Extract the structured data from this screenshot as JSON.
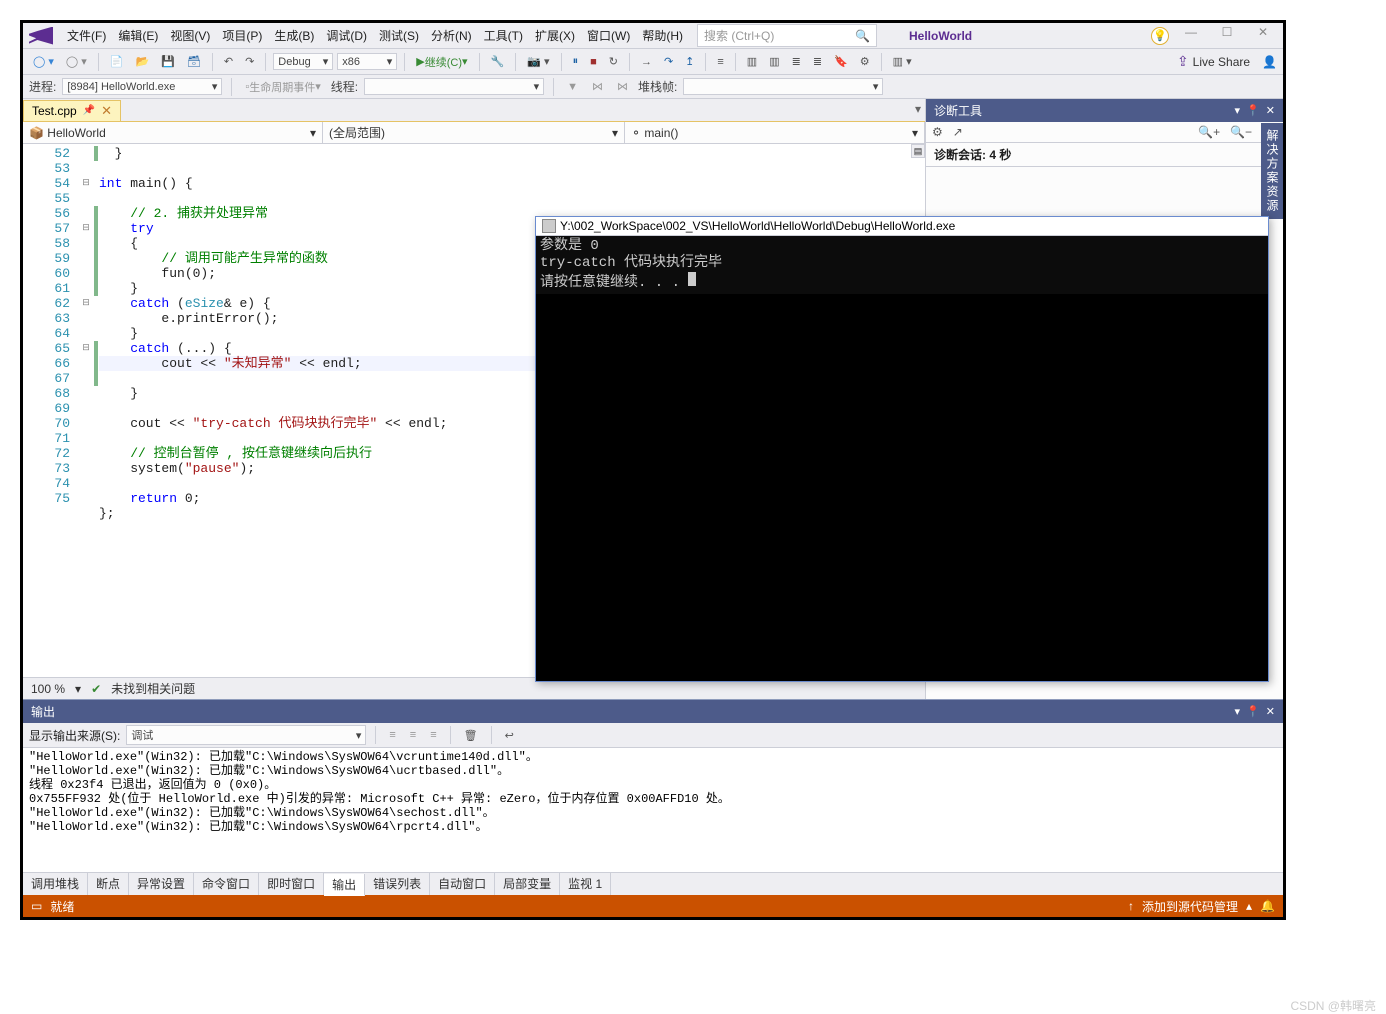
{
  "menu": {
    "items": [
      "文件(F)",
      "编辑(E)",
      "视图(V)",
      "项目(P)",
      "生成(B)",
      "调试(D)",
      "测试(S)",
      "分析(N)",
      "工具(T)",
      "扩展(X)",
      "窗口(W)",
      "帮助(H)"
    ]
  },
  "search_placeholder": "搜索 (Ctrl+Q)",
  "solution_name": "HelloWorld",
  "toolbar": {
    "config": "Debug",
    "platform": "x86",
    "continue": "继续(C)",
    "live_share": "Live Share"
  },
  "toolbar2": {
    "process_label": "进程:",
    "process": "[8984] HelloWorld.exe",
    "lifecycle": "生命周期事件",
    "thread_label": "线程:",
    "stackframe": "堆栈帧:"
  },
  "doc": {
    "tab": "Test.cpp",
    "scope": "HelloWorld",
    "scope2": "(全局范围)",
    "scope3": "main()"
  },
  "code": {
    "lines": [
      {
        "n": 52,
        "c": "g",
        "html": "  }"
      },
      {
        "n": 53,
        "c": "",
        "html": ""
      },
      {
        "n": 54,
        "c": "",
        "fold": "⊟",
        "html": "<span class='kw'>int</span> main() {"
      },
      {
        "n": 55,
        "c": "",
        "html": ""
      },
      {
        "n": 56,
        "c": "g",
        "html": "    <span class='cm'>// 2. 捕获并处理异常</span>"
      },
      {
        "n": 57,
        "c": "g",
        "fold": "⊟",
        "html": "    <span class='kw'>try</span>"
      },
      {
        "n": 58,
        "c": "g",
        "html": "    {"
      },
      {
        "n": 59,
        "c": "g",
        "html": "        <span class='cm'>// 调用可能产生异常的函数</span>"
      },
      {
        "n": 60,
        "c": "g",
        "html": "        fun(0);"
      },
      {
        "n": 61,
        "c": "g",
        "html": "    }"
      },
      {
        "n": 62,
        "c": "",
        "fold": "⊟",
        "html": "    <span class='kw'>catch</span> (<span class='ty'>eSize</span>&amp; e) {"
      },
      {
        "n": 63,
        "c": "",
        "html": "        e.printError();"
      },
      {
        "n": 64,
        "c": "",
        "html": "    }"
      },
      {
        "n": 65,
        "c": "g",
        "fold": "⊟",
        "html": "    <span class='kw'>catch</span> (...) {"
      },
      {
        "n": 66,
        "c": "g",
        "hl": true,
        "html": "        cout &lt;&lt; <span class='st'>\"未知异常\"</span> &lt;&lt; endl;"
      },
      {
        "n": 67,
        "c": "g",
        "html": "    }"
      },
      {
        "n": 68,
        "c": "",
        "html": ""
      },
      {
        "n": 69,
        "c": "",
        "html": "    cout &lt;&lt; <span class='st'>\"try-catch 代码块执行完毕\"</span> &lt;&lt; endl;"
      },
      {
        "n": 70,
        "c": "",
        "html": ""
      },
      {
        "n": 71,
        "c": "",
        "html": "    <span class='cm'>// 控制台暂停 , 按任意键继续向后执行</span>"
      },
      {
        "n": 72,
        "c": "",
        "html": "    system(<span class='st'>\"pause\"</span>);"
      },
      {
        "n": 73,
        "c": "",
        "html": ""
      },
      {
        "n": 74,
        "c": "",
        "html": "    <span class='kw'>return</span> 0;"
      },
      {
        "n": 75,
        "c": "",
        "html": "};"
      }
    ]
  },
  "editor_stat": {
    "zoom": "100 %",
    "issues": "未找到相关问题"
  },
  "diag": {
    "title": "诊断工具",
    "session": "诊断会话: 4 秒"
  },
  "side_tab": "解决方案资源",
  "console": {
    "title": "Y:\\002_WorkSpace\\002_VS\\HelloWorld\\HelloWorld\\Debug\\HelloWorld.exe",
    "lines": [
      "参数是 0",
      "try-catch 代码块执行完毕",
      "请按任意键继续. . . "
    ]
  },
  "output": {
    "title": "输出",
    "src_label": "显示输出来源(S):",
    "src": "调试",
    "lines": [
      "\"HelloWorld.exe\"(Win32): 已加载\"C:\\Windows\\SysWOW64\\vcruntime140d.dll\"。",
      "\"HelloWorld.exe\"(Win32): 已加载\"C:\\Windows\\SysWOW64\\ucrtbased.dll\"。",
      "线程 0x23f4 已退出，返回值为 0 (0x0)。",
      "0x755FF932 处(位于 HelloWorld.exe 中)引发的异常: Microsoft C++ 异常: eZero，位于内存位置 0x00AFFD10 处。",
      "\"HelloWorld.exe\"(Win32): 已加载\"C:\\Windows\\SysWOW64\\sechost.dll\"。",
      "\"HelloWorld.exe\"(Win32): 已加载\"C:\\Windows\\SysWOW64\\rpcrt4.dll\"。"
    ],
    "tabs": [
      "调用堆栈",
      "断点",
      "异常设置",
      "命令窗口",
      "即时窗口",
      "输出",
      "错误列表",
      "自动窗口",
      "局部变量",
      "监视 1"
    ],
    "active_tab": 5
  },
  "status": {
    "ready": "就绪",
    "source_control": "添加到源代码管理"
  },
  "watermark": "CSDN @韩曙亮"
}
